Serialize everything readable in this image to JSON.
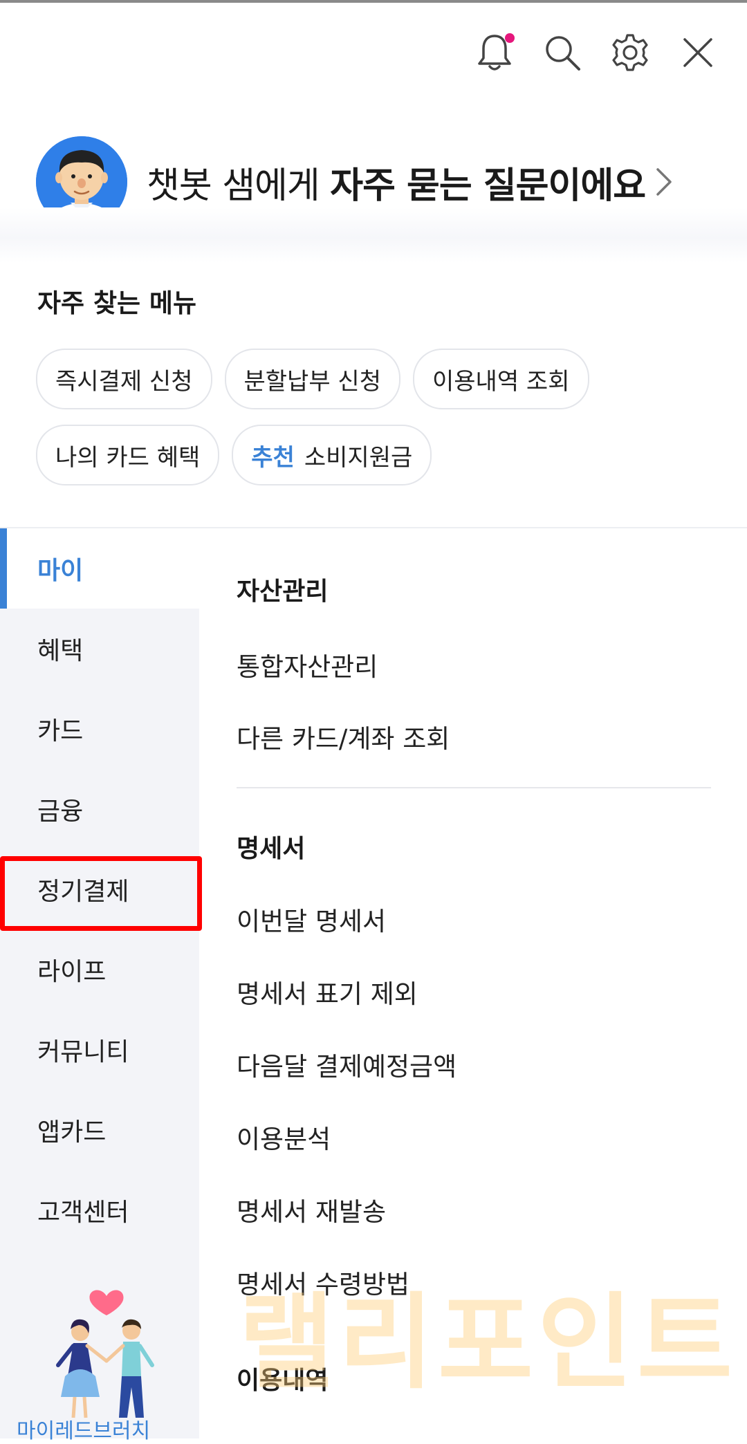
{
  "header": {
    "icons": [
      "bell-icon",
      "search-icon",
      "gear-icon",
      "close-icon"
    ],
    "notification_dot_color": "#e5177c"
  },
  "chatbot": {
    "prefix": "챗봇 샘에게 ",
    "bold": "자주 묻는 질문이에요"
  },
  "frequent_menu": {
    "title": "자주 찾는 메뉴",
    "row1": [
      "즉시결제 신청",
      "분할납부 신청",
      "이용내역 조회"
    ],
    "row2_item1": "나의 카드 혜택",
    "recommended_tag": "추천",
    "recommended_label": "소비지원금"
  },
  "sidebar": {
    "items": [
      "마이",
      "혜택",
      "카드",
      "금융",
      "정기결제",
      "라이프",
      "커뮤니티",
      "앱카드",
      "고객센터"
    ],
    "active_index": 0,
    "accent_color": "#3a82d6",
    "promo_label": "마이레드브러치"
  },
  "content": {
    "asset": {
      "title": "자산관리",
      "items": [
        "통합자산관리",
        "다른 카드/계좌 조회"
      ]
    },
    "statement": {
      "title": "명세서",
      "items": [
        "이번달 명세서",
        "명세서 표기 제외",
        "다음달 결제예정금액",
        "이용분석",
        "명세서 재발송",
        "명세서 수령방법"
      ]
    },
    "usage": {
      "title": "이용내역"
    }
  },
  "watermark": "랠리포인트",
  "highlight_color": "#ff0000"
}
